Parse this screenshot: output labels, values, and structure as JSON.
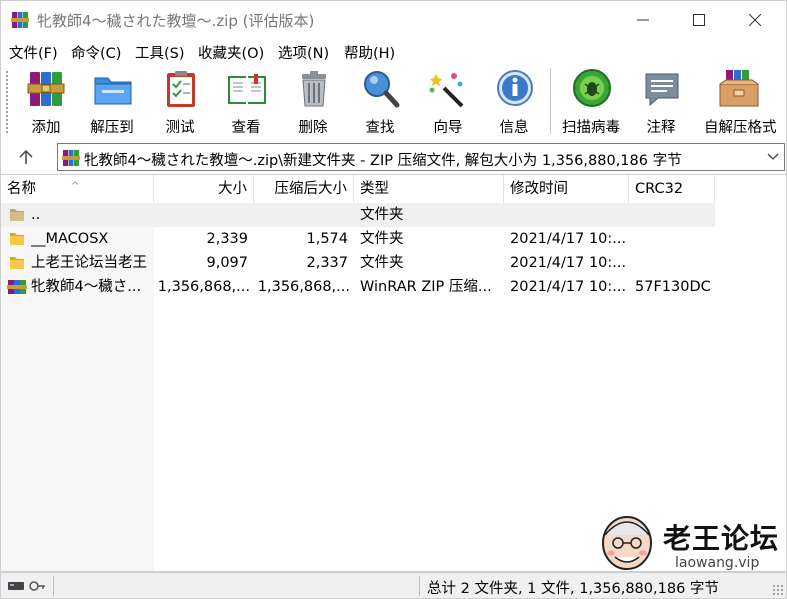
{
  "window": {
    "title": "牝教師4～穢された教壇～.zip (评估版本)",
    "minimize_label": "minimize",
    "maximize_label": "maximize",
    "close_label": "close"
  },
  "menu": [
    "文件(F)",
    "命令(C)",
    "工具(S)",
    "收藏夹(O)",
    "选项(N)",
    "帮助(H)"
  ],
  "toolbar": [
    {
      "label": "添加",
      "icon": "books-add-icon"
    },
    {
      "label": "解压到",
      "icon": "folder-extract-icon"
    },
    {
      "label": "测试",
      "icon": "clipboard-test-icon"
    },
    {
      "label": "查看",
      "icon": "open-book-view-icon"
    },
    {
      "label": "删除",
      "icon": "trash-can-icon"
    },
    {
      "label": "查找",
      "icon": "magnifier-find-icon"
    },
    {
      "label": "向导",
      "icon": "magic-wand-icon"
    },
    {
      "label": "信息",
      "icon": "info-icon"
    },
    {
      "label": "扫描病毒",
      "icon": "virus-scan-icon"
    },
    {
      "label": "注释",
      "icon": "comment-icon"
    },
    {
      "label": "自解压格式",
      "icon": "sfx-box-icon"
    }
  ],
  "address": {
    "path": "牝教師4～穢された教壇～.zip\\新建文件夹 - ZIP 压缩文件, 解包大小为 1,356,880,186 字节"
  },
  "columns": [
    "名称",
    "大小",
    "压缩后大小",
    "类型",
    "修改时间",
    "CRC32"
  ],
  "files": [
    {
      "name": "..",
      "size": "",
      "packed": "",
      "type": "文件夹",
      "modified": "",
      "crc": "",
      "icon": "parent-folder-icon"
    },
    {
      "name": "__MACOSX",
      "size": "2,339",
      "packed": "1,574",
      "type": "文件夹",
      "modified": "2021/4/17 10:...",
      "crc": "",
      "icon": "folder-icon"
    },
    {
      "name": "上老王论坛当老王",
      "size": "9,097",
      "packed": "2,337",
      "type": "文件夹",
      "modified": "2021/4/17 10:...",
      "crc": "",
      "icon": "folder-icon"
    },
    {
      "name": "牝教師4～穢さ...",
      "size": "1,356,868,...",
      "packed": "1,356,868,...",
      "type": "WinRAR ZIP 压缩...",
      "modified": "2021/4/17 10:...",
      "crc": "57F130DC",
      "icon": "winrar-archive-icon"
    }
  ],
  "watermark": {
    "title": "老王论坛",
    "url": "laowang.vip"
  },
  "status": {
    "text": "总计 2 文件夹, 1 文件, 1,356,880,186 字节"
  }
}
